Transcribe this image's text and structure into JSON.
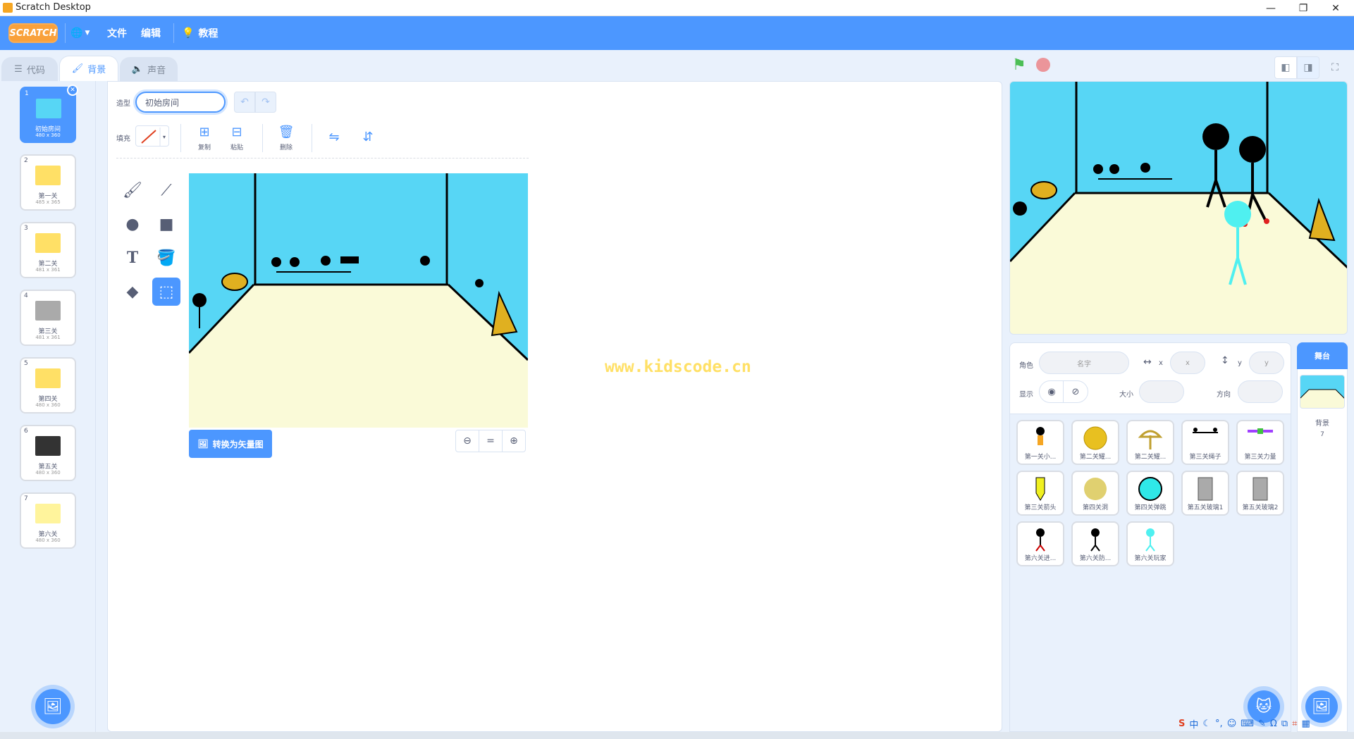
{
  "window": {
    "title": "Scratch Desktop",
    "minimize": "—",
    "restore": "❐",
    "close": "✕"
  },
  "menubar": {
    "logo": "SCRATCH",
    "file": "文件",
    "edit": "编辑",
    "tutorials": "教程"
  },
  "tabs": [
    {
      "label": "代码"
    },
    {
      "label": "背景"
    },
    {
      "label": "声音"
    }
  ],
  "costumes": [
    {
      "num": "1",
      "name": "初始房间",
      "size": "480 x 360",
      "color": "#57d6f5"
    },
    {
      "num": "2",
      "name": "第一关",
      "size": "485 x 365",
      "color": "#ffe066"
    },
    {
      "num": "3",
      "name": "第二关",
      "size": "481 x 361",
      "color": "#ffe066"
    },
    {
      "num": "4",
      "name": "第三关",
      "size": "481 x 361",
      "color": "#aaaaaa"
    },
    {
      "num": "5",
      "name": "第四关",
      "size": "480 x 360",
      "color": "#ffe066"
    },
    {
      "num": "6",
      "name": "第五关",
      "size": "480 x 360",
      "color": "#333333"
    },
    {
      "num": "7",
      "name": "第六关",
      "size": "480 x 360",
      "color": "#fff49c"
    }
  ],
  "editor": {
    "costume_label": "造型",
    "costume_name": "初始房间",
    "fill_label": "填充",
    "copy": "复制",
    "paste": "粘贴",
    "delete": "删除",
    "convert": "转换为矢量图",
    "watermark": "www.kidscode.cn"
  },
  "sprite_info": {
    "sprite_label": "角色",
    "name_placeholder": "名字",
    "x_label": "x",
    "x_placeholder": "x",
    "y_label": "y",
    "y_placeholder": "y",
    "show_label": "显示",
    "size_label": "大小",
    "direction_label": "方向"
  },
  "sprites": [
    {
      "name": "第一关小...",
      "kind": "person-orange"
    },
    {
      "name": "第二关耀...",
      "kind": "circle-gold"
    },
    {
      "name": "第二关耀...",
      "kind": "umbrella"
    },
    {
      "name": "第三关绳子",
      "kind": "rope"
    },
    {
      "name": "第三关力量",
      "kind": "bar-rainbow"
    },
    {
      "name": "第三关箭头",
      "kind": "arrow-yellow"
    },
    {
      "name": "第四关洞",
      "kind": "circle-khaki"
    },
    {
      "name": "第四关弹跳",
      "kind": "circle-cyan"
    },
    {
      "name": "第五关玻璃1",
      "kind": "rect-gray"
    },
    {
      "name": "第五关玻璃2",
      "kind": "rect-gray"
    },
    {
      "name": "第六关进...",
      "kind": "person-red"
    },
    {
      "name": "第六关防...",
      "kind": "person-black"
    },
    {
      "name": "第六关玩家",
      "kind": "person-cyan"
    }
  ],
  "stage_target": {
    "header": "舞台",
    "label": "背景",
    "count": "7"
  },
  "tray": {
    "ime": "中"
  }
}
